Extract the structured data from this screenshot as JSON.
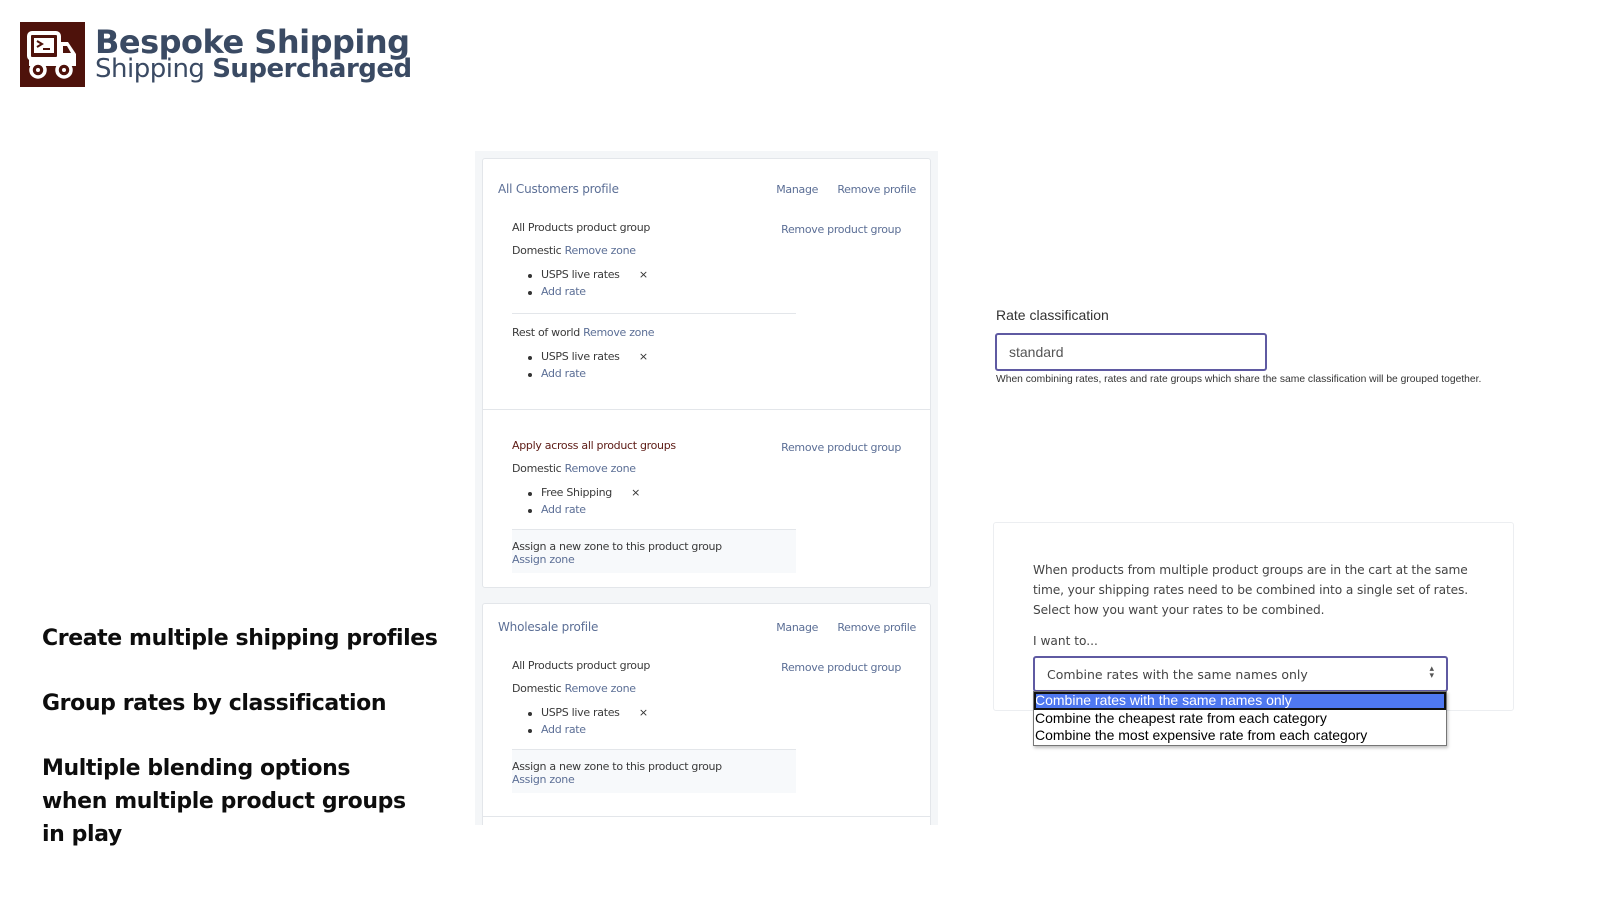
{
  "brand": {
    "logo_icon": "truck-terminal-icon",
    "title": "Bespoke Shipping",
    "subtitle_light": "Shipping",
    "subtitle_bold": "Supercharged",
    "logo_bg_color": "#4e120b",
    "text_color": "#3a4a63"
  },
  "features": [
    "Create multiple shipping profiles",
    "Group rates by classification",
    "Multiple blending options when multiple product groups in play"
  ],
  "profiles": [
    {
      "title": "All Customers profile",
      "manage_label": "Manage",
      "remove_label": "Remove profile",
      "groups": [
        {
          "title": "All Products product group",
          "remove_label": "Remove product group",
          "zones": [
            {
              "name": "Domestic",
              "remove_label": "Remove zone",
              "rates": [
                "USPS live rates"
              ],
              "add_rate_label": "Add rate"
            },
            {
              "name": "Rest of world",
              "remove_label": "Remove zone",
              "rates": [
                "USPS live rates"
              ],
              "add_rate_label": "Add rate"
            }
          ]
        },
        {
          "title": "Apply across all product groups",
          "remove_label": "Remove product group",
          "zones": [
            {
              "name": "Domestic",
              "remove_label": "Remove zone",
              "rates": [
                "Free Shipping"
              ],
              "add_rate_label": "Add rate"
            }
          ],
          "assign_text": "Assign a new zone to this product group",
          "assign_label": "Assign zone"
        }
      ]
    },
    {
      "title": "Wholesale profile",
      "manage_label": "Manage",
      "remove_label": "Remove profile",
      "groups": [
        {
          "title": "All Products product group",
          "remove_label": "Remove product group",
          "zones": [
            {
              "name": "Domestic",
              "remove_label": "Remove zone",
              "rates": [
                "USPS live rates"
              ],
              "add_rate_label": "Add rate"
            }
          ],
          "assign_text": "Assign a new zone to this product group",
          "assign_label": "Assign zone"
        }
      ]
    }
  ],
  "remove_rate_icon": "×",
  "rate_classification": {
    "label": "Rate classification",
    "value": "standard",
    "help": "When combining rates, rates and rate groups which share the same classification will be grouped together."
  },
  "combine": {
    "description": "When products from multiple product groups are in the cart at the same time, your shipping rates need to be combined into a single set of rates. Select how you want your rates to be combined.",
    "label": "I want to...",
    "selected": "Combine rates with the same names only",
    "options": [
      "Combine rates with the same names only",
      "Combine the cheapest rate from each category",
      "Combine the most expensive rate from each category"
    ],
    "highlight_color": "#4f78f0",
    "focus_color": "#5f5aa2"
  }
}
